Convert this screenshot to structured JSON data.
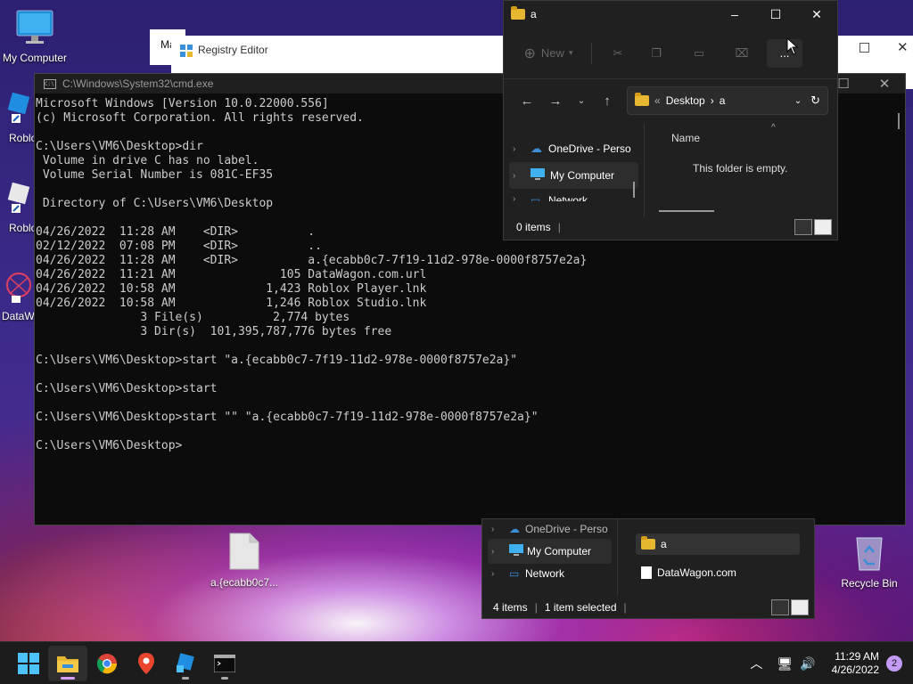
{
  "desktop": {
    "icons": [
      {
        "label": "My Computer"
      },
      {
        "label": "Roblox"
      },
      {
        "label": "Roblox"
      },
      {
        "label": "DataW"
      },
      {
        "label": "a.{ecabb0c7..."
      },
      {
        "label": "Recycle Bin"
      }
    ]
  },
  "manager_title_fragment": "Ma",
  "registry_editor": {
    "title": "Registry Editor"
  },
  "cmd": {
    "title": "C:\\Windows\\System32\\cmd.exe",
    "lines": [
      "Microsoft Windows [Version 10.0.22000.556]",
      "(c) Microsoft Corporation. All rights reserved.",
      "",
      "C:\\Users\\VM6\\Desktop>dir",
      " Volume in drive C has no label.",
      " Volume Serial Number is 081C-EF35",
      "",
      " Directory of C:\\Users\\VM6\\Desktop",
      "",
      "04/26/2022  11:28 AM    <DIR>          .",
      "02/12/2022  07:08 PM    <DIR>          ..",
      "04/26/2022  11:28 AM    <DIR>          a.{ecabb0c7-7f19-11d2-978e-0000f8757e2a}",
      "04/26/2022  11:21 AM               105 DataWagon.com.url",
      "04/26/2022  10:58 AM             1,423 Roblox Player.lnk",
      "04/26/2022  10:58 AM             1,246 Roblox Studio.lnk",
      "               3 File(s)          2,774 bytes",
      "               3 Dir(s)  101,395,787,776 bytes free",
      "",
      "C:\\Users\\VM6\\Desktop>start \"a.{ecabb0c7-7f19-11d2-978e-0000f8757e2a}\"",
      "",
      "C:\\Users\\VM6\\Desktop>start",
      "",
      "C:\\Users\\VM6\\Desktop>start \"\" \"a.{ecabb0c7-7f19-11d2-978e-0000f8757e2a}\"",
      "",
      "C:\\Users\\VM6\\Desktop>"
    ]
  },
  "explorer_top": {
    "title": "a",
    "toolbar": {
      "new_label": "New",
      "more_label": "..."
    },
    "breadcrumb": {
      "prefix": "«",
      "parent": "Desktop",
      "sep": "›",
      "current": "a"
    },
    "nav": [
      {
        "label": "OneDrive - Perso"
      },
      {
        "label": "My Computer"
      },
      {
        "label": "Network"
      }
    ],
    "column_header": "Name",
    "empty_message": "This folder is empty.",
    "status": "0 items"
  },
  "explorer_bottom": {
    "nav": [
      {
        "label": "OneDrive - Perso"
      },
      {
        "label": "My Computer"
      },
      {
        "label": "Network"
      }
    ],
    "files": [
      {
        "name": "a"
      },
      {
        "name": "DataWagon.com"
      }
    ],
    "status_items": "4 items",
    "status_selected": "1 item selected"
  },
  "taskbar": {
    "apps": [
      "start-button",
      "file-explorer",
      "chrome",
      "maps",
      "roblox-studio",
      "terminal"
    ],
    "time": "11:29 AM",
    "date": "4/26/2022",
    "notification_count": "2"
  }
}
